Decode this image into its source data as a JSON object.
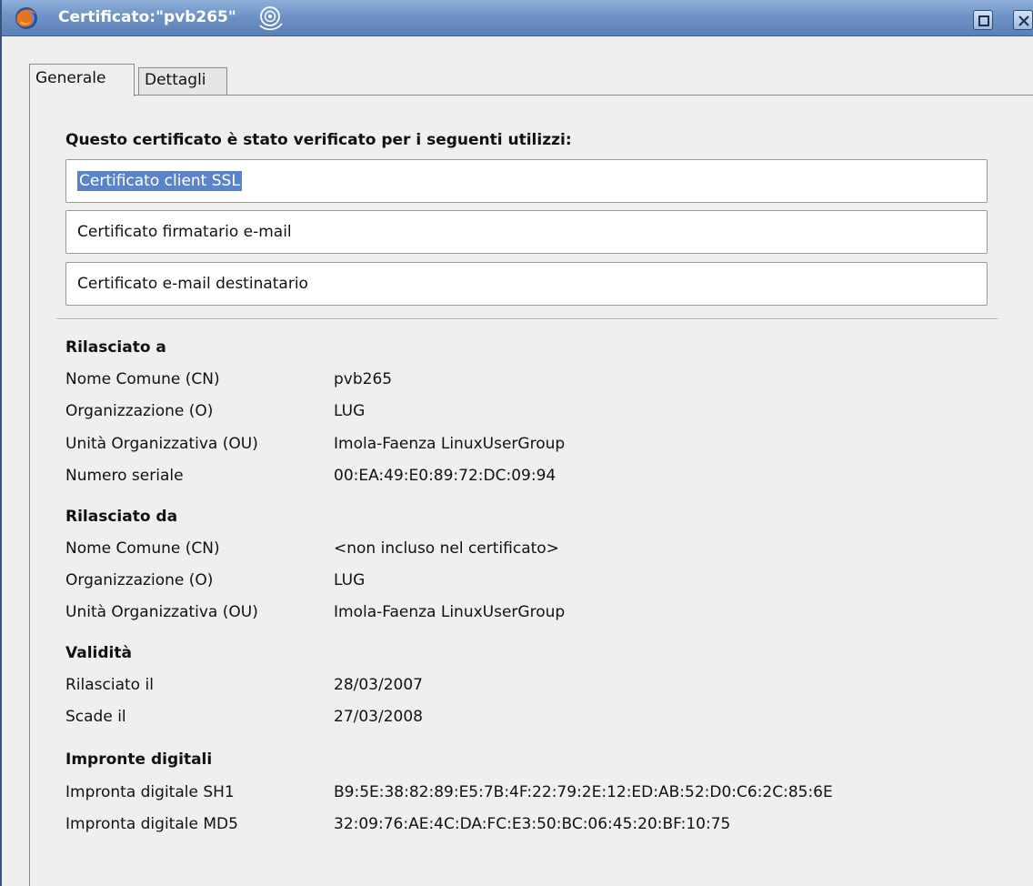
{
  "window": {
    "title": "Certificato:\"pvb265\"",
    "titlebar_color": "#6f93c6",
    "selection_color": "#5b84c8"
  },
  "tabs": [
    {
      "label": "Generale",
      "active": true
    },
    {
      "label": "Dettagli",
      "active": false
    }
  ],
  "general": {
    "verified_heading": "Questo certificato è stato verificato per i seguenti utilizzi:",
    "usages": [
      "Certificato client SSL",
      "Certificato firmatario e-mail",
      "Certificato e-mail destinatario"
    ],
    "issued_to": {
      "title": "Rilasciato a",
      "rows": [
        {
          "label": "Nome Comune (CN)",
          "value": "pvb265"
        },
        {
          "label": "Organizzazione (O)",
          "value": "LUG"
        },
        {
          "label": "Unità Organizzativa (OU)",
          "value": "Imola-Faenza LinuxUserGroup"
        },
        {
          "label": "Numero seriale",
          "value": "00:EA:49:E0:89:72:DC:09:94"
        }
      ]
    },
    "issued_by": {
      "title": "Rilasciato da",
      "rows": [
        {
          "label": "Nome Comune (CN)",
          "value": "<non incluso nel certificato>"
        },
        {
          "label": "Organizzazione (O)",
          "value": "LUG"
        },
        {
          "label": "Unità Organizzativa (OU)",
          "value": "Imola-Faenza LinuxUserGroup"
        }
      ]
    },
    "validity": {
      "title": "Validità",
      "rows": [
        {
          "label": "Rilasciato il",
          "value": "28/03/2007"
        },
        {
          "label": "Scade il",
          "value": "27/03/2008"
        }
      ]
    },
    "fingerprints": {
      "title": "Impronte digitali",
      "rows": [
        {
          "label": "Impronta digitale SH1",
          "value": "B9:5E:38:82:89:E5:7B:4F:22:79:2E:12:ED:AB:52:D0:C6:2C:85:6E"
        },
        {
          "label": "Impronta digitale MD5",
          "value": "32:09:76:AE:4C:DA:FC:E3:50:BC:06:45:20:BF:10:75"
        }
      ]
    }
  }
}
